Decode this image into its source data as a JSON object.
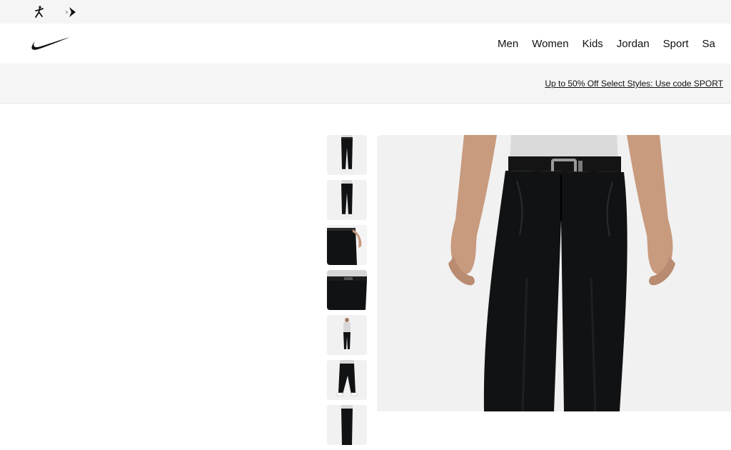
{
  "utility": {
    "brands": [
      {
        "icon": "jordan-jumpman-icon"
      },
      {
        "icon": "converse-chevron-star-icon"
      }
    ]
  },
  "header": {
    "logo_icon": "nike-swoosh-icon",
    "nav": [
      "Men",
      "Women",
      "Kids",
      "Jordan",
      "Sport",
      "Sa"
    ]
  },
  "promo": {
    "text": "Up to 50% Off Select Styles: Use code SPORT"
  },
  "gallery": {
    "thumbnails": [
      {
        "view": "front"
      },
      {
        "view": "back"
      },
      {
        "view": "pocket-detail"
      },
      {
        "view": "waistband-detail"
      },
      {
        "view": "full-body"
      },
      {
        "view": "side-stride"
      },
      {
        "view": "partial"
      }
    ],
    "main_image": "black golf trousers front view",
    "colors": {
      "pants": "#111214",
      "skin": "#c89a7e",
      "shirt": "#dadada",
      "background": "#f1f1f1"
    }
  }
}
